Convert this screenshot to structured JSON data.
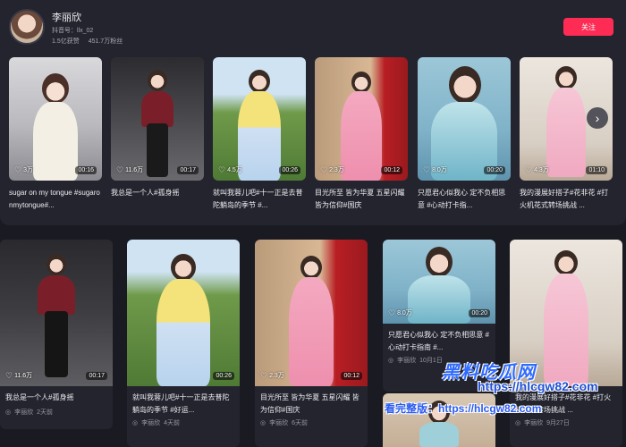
{
  "profile": {
    "name": "李丽欣",
    "handle": "抖音号：llx_02",
    "likes": "1.5亿获赞",
    "followers": "451.7万粉丝",
    "follow_label": "关注"
  },
  "top_videos": [
    {
      "likes": "3万",
      "duration": "00:16",
      "title": "sugar on my tongue #sugaronmytongue#..."
    },
    {
      "likes": "11.6万",
      "duration": "00:17",
      "title": "我总是一个人#孤身摇"
    },
    {
      "likes": "4.5万",
      "duration": "00:26",
      "title": "就叫我蓉儿吧#十一正是去普陀躺岛的季节 #..."
    },
    {
      "likes": "2.3万",
      "duration": "00:12",
      "title": "目光所至 皆为华夏 五星闪耀 皆为信仰#国庆"
    },
    {
      "likes": "8.0万",
      "duration": "00:20",
      "title": "只愿君心似我心 定不负相思意 #心动打卡指..."
    },
    {
      "likes": "4.3万",
      "duration": "01:10",
      "title": "我的漫展好搭子#花非花 #打火机花式转场挑战 ..."
    }
  ],
  "bottom_videos": [
    {
      "likes": "11.6万",
      "duration": "00:17",
      "title": "我总是一个人#孤身摇",
      "author": "李丽欣",
      "time": "2天前"
    },
    {
      "likes": "",
      "duration": "00:26",
      "title": "就叫我蓉儿吧#十一正是去普陀躺岛的季节 #好运...",
      "author": "李丽欣",
      "time": "4天前"
    },
    {
      "likes": "2.3万",
      "duration": "00:12",
      "title": "目光所至 皆为华夏 五星闪耀 皆为信仰#国庆",
      "author": "李丽欣",
      "time": "6天前"
    },
    {
      "likes": "8.0万",
      "duration": "00:20",
      "title": "只愿君心似我心 定不负相思意 #心动打卡指南 #...",
      "author": "李丽欣",
      "time": "10月1日"
    },
    {
      "likes": "",
      "duration": "",
      "title": "我的漫展好搭子#花非花 #打火机花式转场挑战 ...",
      "author": "李丽欣",
      "time": "9月27日"
    }
  ],
  "watermark": {
    "brand": "黑料吃瓜网",
    "url": "https://hlcgw82.com",
    "prefix": "看完整版："
  },
  "icons": {
    "heart": "heart-icon",
    "next": "chevron-right-icon",
    "author": "user-icon"
  }
}
